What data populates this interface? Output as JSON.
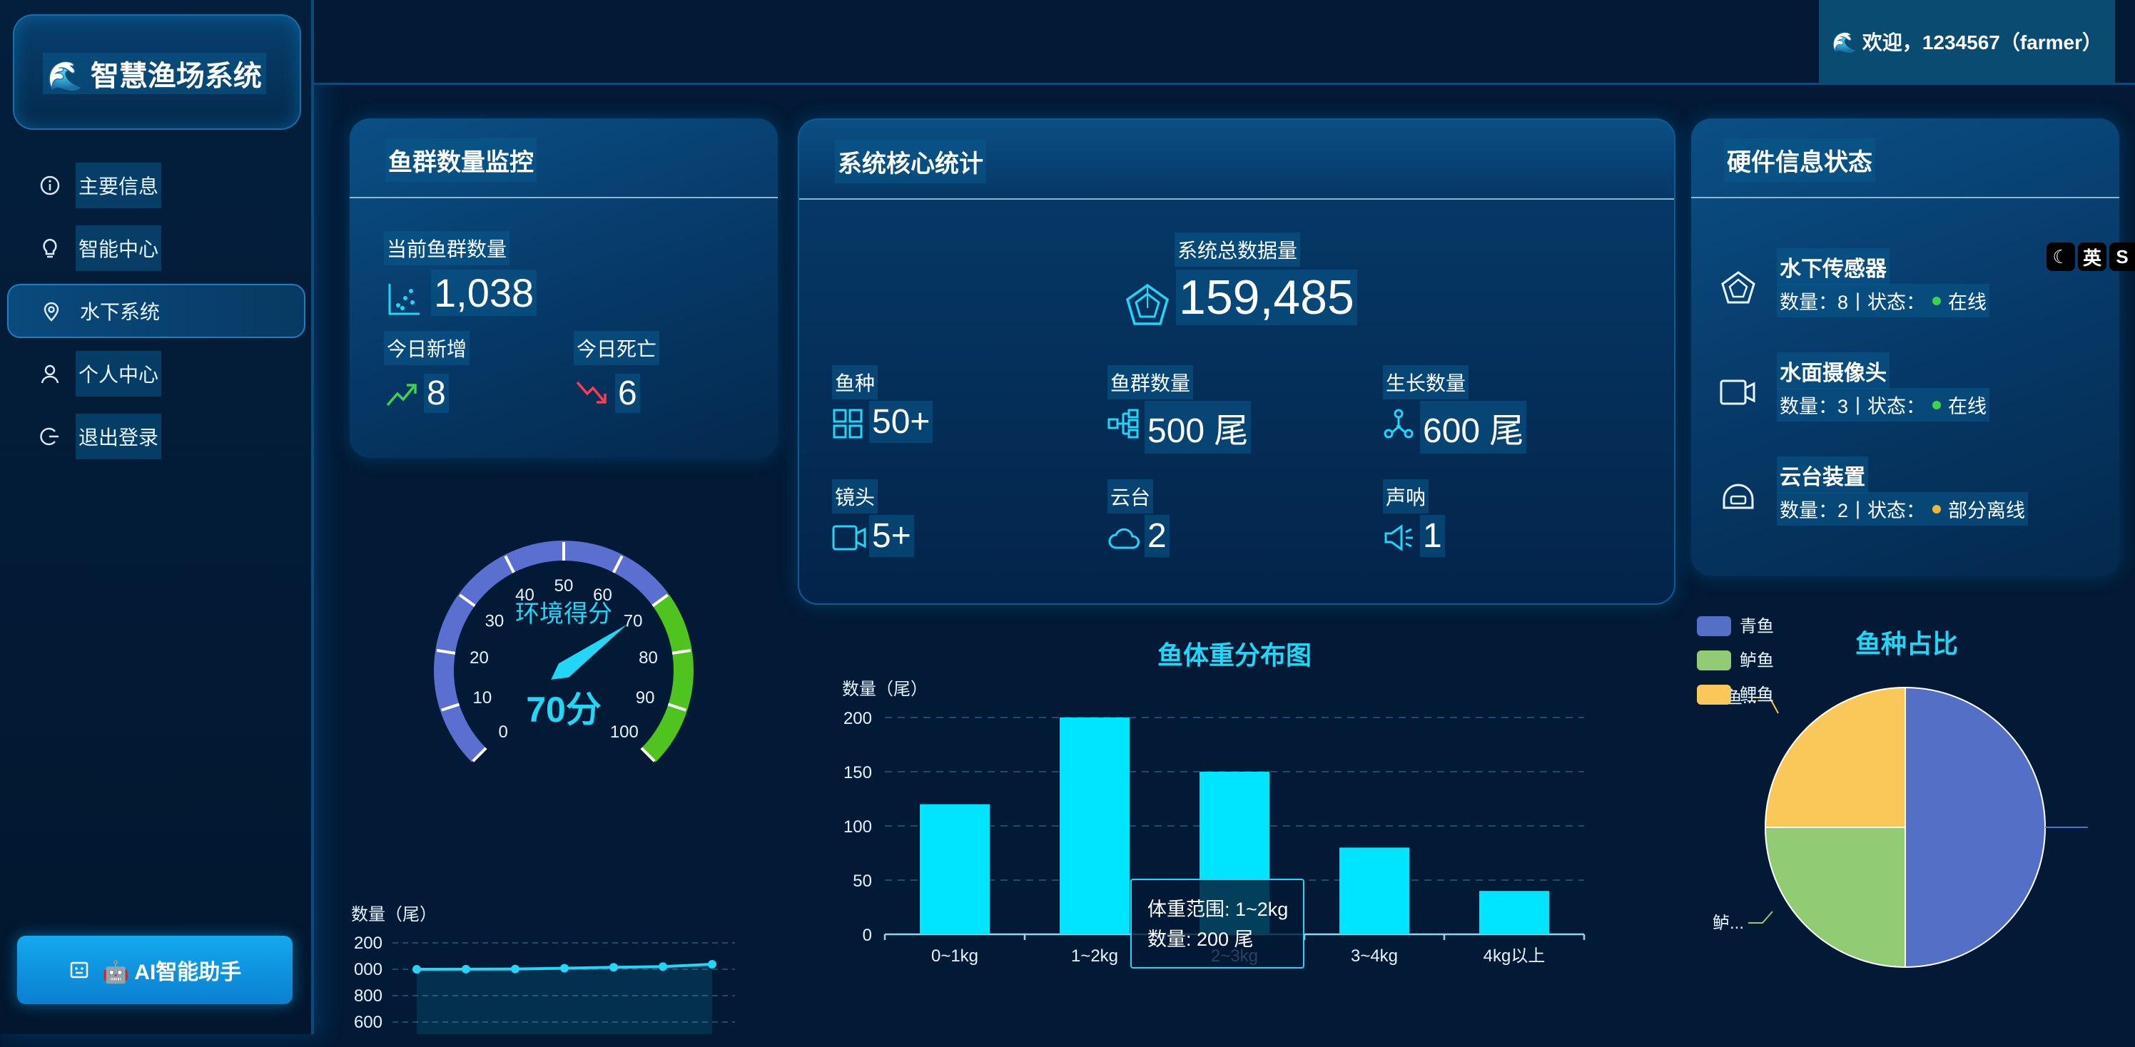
{
  "app": {
    "logo_text": "🌊 智慧渔场系统",
    "welcome": "🌊 欢迎，1234567（farmer）"
  },
  "sidebar": {
    "items": [
      {
        "label": "主要信息",
        "icon": "info-icon"
      },
      {
        "label": "智能中心",
        "icon": "lightbulb-icon"
      },
      {
        "label": "水下系统",
        "icon": "location-pin-icon",
        "active": true
      },
      {
        "label": "个人中心",
        "icon": "user-icon"
      },
      {
        "label": "退出登录",
        "icon": "logout-icon"
      }
    ],
    "ai_button": "🤖 AI智能助手"
  },
  "fish_monitor": {
    "title": "鱼群数量监控",
    "current_label": "当前鱼群数量",
    "current_value": "1,038",
    "new_label": "今日新增",
    "new_value": "8",
    "death_label": "今日死亡",
    "death_value": "6"
  },
  "core_stats": {
    "title": "系统核心统计",
    "total_label": "系统总数据量",
    "total_value": "159,485",
    "items": [
      {
        "label": "鱼种",
        "value": "50+",
        "icon": "grid-icon"
      },
      {
        "label": "鱼群数量",
        "value": "500 尾",
        "icon": "tree-structure-icon"
      },
      {
        "label": "生长数量",
        "value": "600 尾",
        "icon": "nodes-icon"
      },
      {
        "label": "镜头",
        "value": "5+",
        "icon": "video-camera-icon"
      },
      {
        "label": "云台",
        "value": "2",
        "icon": "cloud-icon"
      },
      {
        "label": "声呐",
        "value": "1",
        "icon": "speaker-icon"
      }
    ]
  },
  "hardware": {
    "title": "硬件信息状态",
    "items": [
      {
        "name": "水下传感器",
        "count_text": "数量：8",
        "sep": "|",
        "status_label": "状态：",
        "status": "在线",
        "status_color": "#3fd24b",
        "icon": "sensor-pentagon-icon"
      },
      {
        "name": "水面摄像头",
        "count_text": "数量：3",
        "sep": "|",
        "status_label": "状态：",
        "status": "在线",
        "status_color": "#3fd24b",
        "icon": "camera-icon"
      },
      {
        "name": "云台装置",
        "count_text": "数量：2",
        "sep": "|",
        "status_label": "状态：",
        "status": "部分离线",
        "status_color": "#f2b233",
        "icon": "device-icon"
      }
    ],
    "ime_toggle": {
      "moon": "☾",
      "lang": "英",
      "s": "S"
    }
  },
  "gauge": {
    "label": "环境得分",
    "value_text": "70分",
    "score": 70,
    "min": 0,
    "max": 100,
    "ticks": [
      "0",
      "10",
      "20",
      "30",
      "40",
      "50",
      "60",
      "70",
      "80",
      "90",
      "100"
    ]
  },
  "trend_chart": {
    "ylabel": "数量（尾）",
    "ytick_labels": [
      "200",
      "000",
      "800",
      "600"
    ]
  },
  "chart_data": [
    {
      "type": "bar",
      "title": "鱼体重分布图",
      "ylabel": "数量（尾）",
      "categories": [
        "0~1kg",
        "1~2kg",
        "2~3kg",
        "3~4kg",
        "4kg以上"
      ],
      "values": [
        120,
        200,
        150,
        80,
        40
      ],
      "ylim": [
        0,
        200
      ],
      "yticks": [
        0,
        50,
        100,
        150,
        200
      ],
      "color": "#00e5ff",
      "grid": true,
      "tooltip": {
        "line1": "体重范围: 1~2kg",
        "line2": "数量: 200 尾"
      }
    },
    {
      "type": "pie",
      "title": "鱼种占比",
      "categories": [
        "青鱼",
        "鲈鱼",
        "鲤鱼"
      ],
      "values": [
        50,
        25,
        25
      ],
      "colors": [
        "#5470c6",
        "#91cc75",
        "#fac858"
      ],
      "legend": "top-left",
      "slice_labels": [
        "鲤鱼...",
        "鲈..."
      ]
    },
    {
      "type": "line",
      "ylabel": "数量（尾）",
      "x": [
        1,
        2,
        3,
        4,
        5,
        6,
        7
      ],
      "values": [
        1000,
        1001,
        1002,
        1008,
        1015,
        1020,
        1038
      ],
      "color": "#22d6f5"
    }
  ]
}
